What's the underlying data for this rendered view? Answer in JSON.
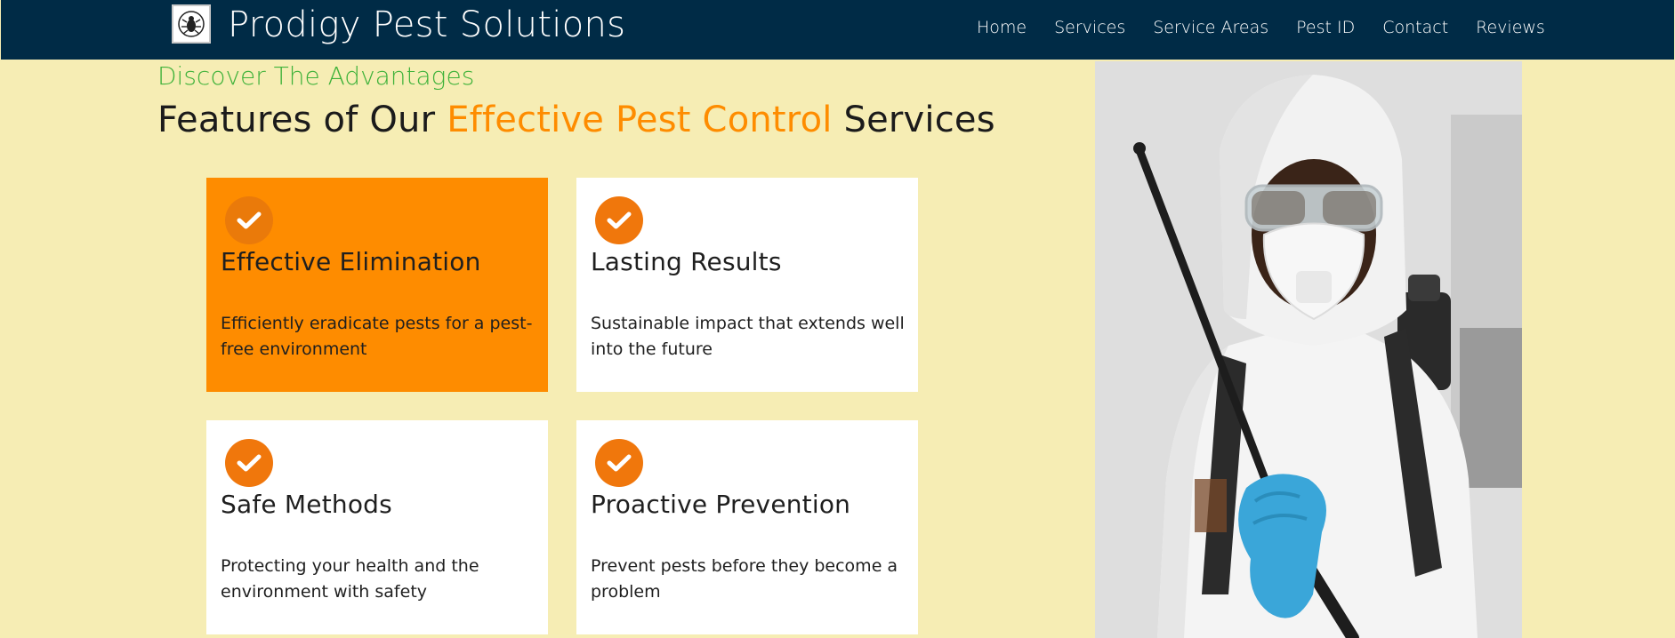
{
  "navbar": {
    "brand": "Prodigy Pest Solutions",
    "logo_icon": "bug-shield-icon",
    "links": [
      "Home",
      "Services",
      "Service Areas",
      "Pest ID",
      "Contact",
      "Reviews"
    ]
  },
  "section": {
    "eyebrow": "Discover The Advantages",
    "headline_prefix": "Features of Our ",
    "headline_accent": "Effective Pest Control",
    "headline_suffix": " Services"
  },
  "features": [
    {
      "title": "Effective Elimination",
      "description": "Efficiently eradicate pests for a pest-free environment",
      "icon": "check-circle-icon",
      "active": true
    },
    {
      "title": "Lasting Results",
      "description": "Sustainable impact that extends well into the future",
      "icon": "check-circle-icon",
      "active": false
    },
    {
      "title": "Safe Methods",
      "description": "Protecting your health and the environment with safety",
      "icon": "check-circle-icon",
      "active": false
    },
    {
      "title": "Proactive Prevention",
      "description": "Prevent pests before they become a problem",
      "icon": "check-circle-icon",
      "active": false
    }
  ],
  "photo": {
    "subject": "technician-in-protective-suit-with-sprayer"
  },
  "colors": {
    "nav_bg": "#002b46",
    "page_bg": "#f6edb4",
    "accent_orange": "#fe8c00",
    "eyebrow_green": "#3fb23a",
    "card_bg": "#ffffff"
  }
}
